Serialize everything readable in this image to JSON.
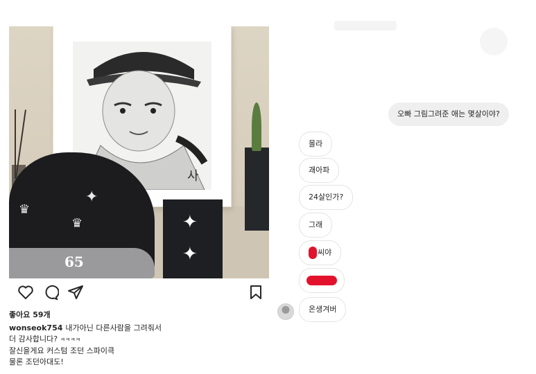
{
  "post": {
    "likes": "좋아요 59개",
    "username": "wonseok754",
    "caption_line1": "내가아닌 다른사람을 그려줘서",
    "caption_line2_text": "더 감사합니다? ",
    "caption_line2_laugh": "ㅋㅋㅋㅋ",
    "caption_line3": "잘신을게요 커스텀 조던 스파이큭",
    "caption_line4": "물론 조던아대도!",
    "shoe_number": "65",
    "icons": [
      "heart-icon",
      "comment-icon",
      "share-icon",
      "bookmark-icon"
    ]
  },
  "chat": {
    "outgoing": "오빠 그림그려준 애는 몇살이야?",
    "replies": [
      {
        "id": "reply-1",
        "text": "몰라"
      },
      {
        "id": "reply-2",
        "text": "괘아파"
      },
      {
        "id": "reply-3",
        "text": "24살인가?"
      },
      {
        "id": "reply-4",
        "text": "그래"
      },
      {
        "id": "reply-5",
        "text": "씨야",
        "redacted_prefix": true
      },
      {
        "id": "reply-6",
        "text": "",
        "fully_redacted": true
      },
      {
        "id": "reply-7",
        "text": "온생겨버"
      }
    ],
    "redaction_color": "#e3122c"
  }
}
